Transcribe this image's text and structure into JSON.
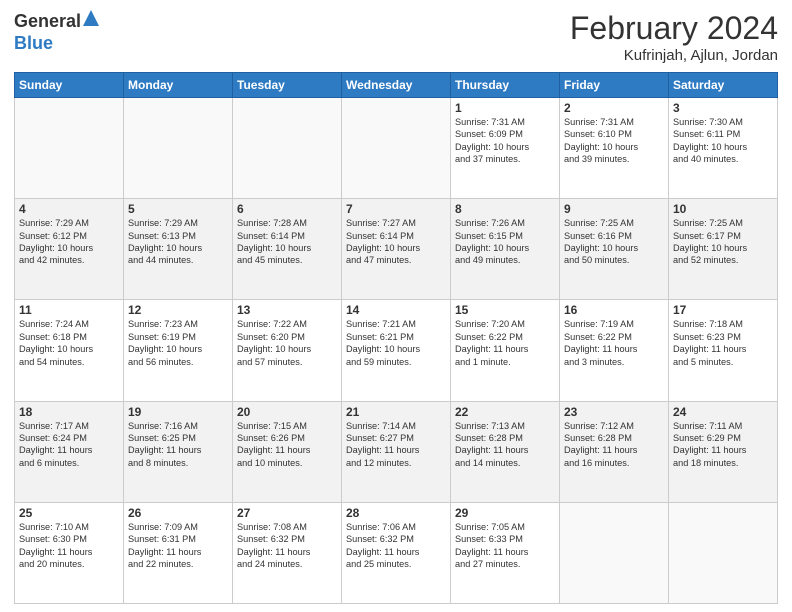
{
  "logo": {
    "general": "General",
    "blue": "Blue"
  },
  "header": {
    "month_year": "February 2024",
    "location": "Kufrinjah, Ajlun, Jordan"
  },
  "weekdays": [
    "Sunday",
    "Monday",
    "Tuesday",
    "Wednesday",
    "Thursday",
    "Friday",
    "Saturday"
  ],
  "weeks": [
    [
      {
        "day": "",
        "info": ""
      },
      {
        "day": "",
        "info": ""
      },
      {
        "day": "",
        "info": ""
      },
      {
        "day": "",
        "info": ""
      },
      {
        "day": "1",
        "info": "Sunrise: 7:31 AM\nSunset: 6:09 PM\nDaylight: 10 hours\nand 37 minutes."
      },
      {
        "day": "2",
        "info": "Sunrise: 7:31 AM\nSunset: 6:10 PM\nDaylight: 10 hours\nand 39 minutes."
      },
      {
        "day": "3",
        "info": "Sunrise: 7:30 AM\nSunset: 6:11 PM\nDaylight: 10 hours\nand 40 minutes."
      }
    ],
    [
      {
        "day": "4",
        "info": "Sunrise: 7:29 AM\nSunset: 6:12 PM\nDaylight: 10 hours\nand 42 minutes."
      },
      {
        "day": "5",
        "info": "Sunrise: 7:29 AM\nSunset: 6:13 PM\nDaylight: 10 hours\nand 44 minutes."
      },
      {
        "day": "6",
        "info": "Sunrise: 7:28 AM\nSunset: 6:14 PM\nDaylight: 10 hours\nand 45 minutes."
      },
      {
        "day": "7",
        "info": "Sunrise: 7:27 AM\nSunset: 6:14 PM\nDaylight: 10 hours\nand 47 minutes."
      },
      {
        "day": "8",
        "info": "Sunrise: 7:26 AM\nSunset: 6:15 PM\nDaylight: 10 hours\nand 49 minutes."
      },
      {
        "day": "9",
        "info": "Sunrise: 7:25 AM\nSunset: 6:16 PM\nDaylight: 10 hours\nand 50 minutes."
      },
      {
        "day": "10",
        "info": "Sunrise: 7:25 AM\nSunset: 6:17 PM\nDaylight: 10 hours\nand 52 minutes."
      }
    ],
    [
      {
        "day": "11",
        "info": "Sunrise: 7:24 AM\nSunset: 6:18 PM\nDaylight: 10 hours\nand 54 minutes."
      },
      {
        "day": "12",
        "info": "Sunrise: 7:23 AM\nSunset: 6:19 PM\nDaylight: 10 hours\nand 56 minutes."
      },
      {
        "day": "13",
        "info": "Sunrise: 7:22 AM\nSunset: 6:20 PM\nDaylight: 10 hours\nand 57 minutes."
      },
      {
        "day": "14",
        "info": "Sunrise: 7:21 AM\nSunset: 6:21 PM\nDaylight: 10 hours\nand 59 minutes."
      },
      {
        "day": "15",
        "info": "Sunrise: 7:20 AM\nSunset: 6:22 PM\nDaylight: 11 hours\nand 1 minute."
      },
      {
        "day": "16",
        "info": "Sunrise: 7:19 AM\nSunset: 6:22 PM\nDaylight: 11 hours\nand 3 minutes."
      },
      {
        "day": "17",
        "info": "Sunrise: 7:18 AM\nSunset: 6:23 PM\nDaylight: 11 hours\nand 5 minutes."
      }
    ],
    [
      {
        "day": "18",
        "info": "Sunrise: 7:17 AM\nSunset: 6:24 PM\nDaylight: 11 hours\nand 6 minutes."
      },
      {
        "day": "19",
        "info": "Sunrise: 7:16 AM\nSunset: 6:25 PM\nDaylight: 11 hours\nand 8 minutes."
      },
      {
        "day": "20",
        "info": "Sunrise: 7:15 AM\nSunset: 6:26 PM\nDaylight: 11 hours\nand 10 minutes."
      },
      {
        "day": "21",
        "info": "Sunrise: 7:14 AM\nSunset: 6:27 PM\nDaylight: 11 hours\nand 12 minutes."
      },
      {
        "day": "22",
        "info": "Sunrise: 7:13 AM\nSunset: 6:28 PM\nDaylight: 11 hours\nand 14 minutes."
      },
      {
        "day": "23",
        "info": "Sunrise: 7:12 AM\nSunset: 6:28 PM\nDaylight: 11 hours\nand 16 minutes."
      },
      {
        "day": "24",
        "info": "Sunrise: 7:11 AM\nSunset: 6:29 PM\nDaylight: 11 hours\nand 18 minutes."
      }
    ],
    [
      {
        "day": "25",
        "info": "Sunrise: 7:10 AM\nSunset: 6:30 PM\nDaylight: 11 hours\nand 20 minutes."
      },
      {
        "day": "26",
        "info": "Sunrise: 7:09 AM\nSunset: 6:31 PM\nDaylight: 11 hours\nand 22 minutes."
      },
      {
        "day": "27",
        "info": "Sunrise: 7:08 AM\nSunset: 6:32 PM\nDaylight: 11 hours\nand 24 minutes."
      },
      {
        "day": "28",
        "info": "Sunrise: 7:06 AM\nSunset: 6:32 PM\nDaylight: 11 hours\nand 25 minutes."
      },
      {
        "day": "29",
        "info": "Sunrise: 7:05 AM\nSunset: 6:33 PM\nDaylight: 11 hours\nand 27 minutes."
      },
      {
        "day": "",
        "info": ""
      },
      {
        "day": "",
        "info": ""
      }
    ]
  ]
}
